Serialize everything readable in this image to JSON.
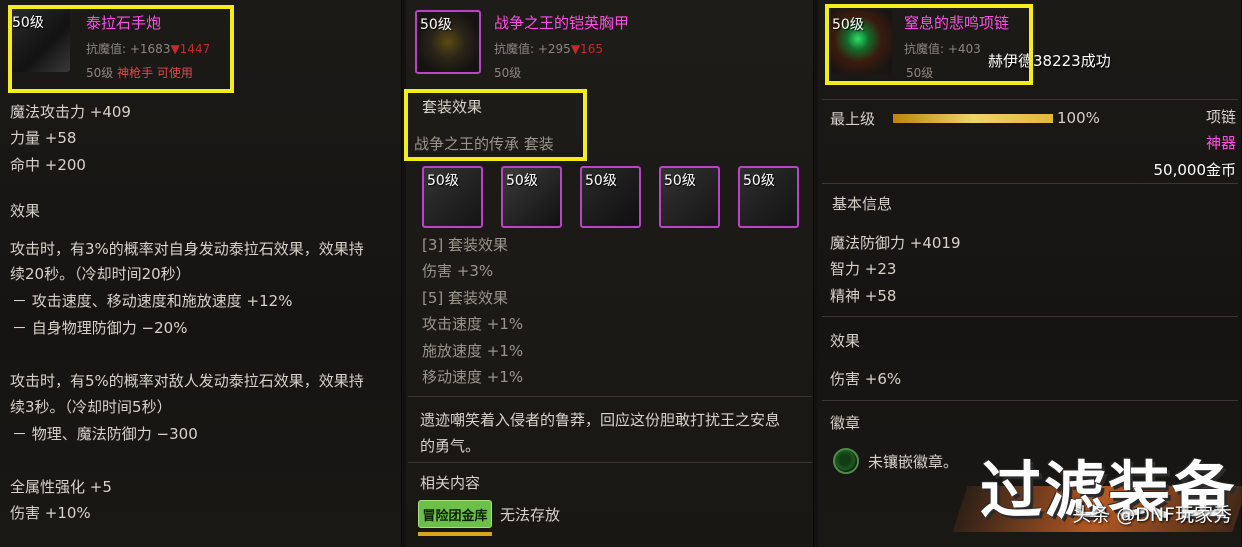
{
  "panel1": {
    "level": "50级",
    "name": "泰拉石手炮",
    "resist_label": "抗魔值: +1683",
    "resist_down": "▼1447",
    "req_level": "50级",
    "req_class": "神枪手 可使用",
    "stats": [
      "魔法攻击力 +409",
      "力量 +58",
      "命中 +200"
    ],
    "effect_header": "效果",
    "effect_lines": [
      "攻击时，有3%的概率对自身发动泰拉石效果，效果持",
      "续20秒。（冷却时间20秒）",
      "－ 攻击速度、移动速度和施放速度 +12%",
      "－ 自身物理防御力 −20%",
      "攻击时，有5%的概率对敌人发动泰拉石效果，效果持",
      "续3秒。（冷却时间5秒）",
      "－ 物理、魔法防御力 −300",
      "全属性强化 +5",
      "伤害 +10%"
    ]
  },
  "panel2": {
    "level": "50级",
    "name": "战争之王的铠英胸甲",
    "resist_label": "抗魔值: +295",
    "resist_down": "▼165",
    "req_level": "50级",
    "set_header": "套装效果",
    "set_name": "战争之王的传承  套装",
    "slots": [
      "50级",
      "50级",
      "50级",
      "50级",
      "50级"
    ],
    "set_bonus": [
      "[3] 套装效果",
      "伤害 +3%",
      "[5] 套装效果",
      "攻击速度 +1%",
      "施放速度 +1%",
      "移动速度 +1%"
    ],
    "desc": [
      "遗迹嘲笑着入侵者的鲁莽，回应这份胆敢打扰王之安息",
      "的勇气。"
    ],
    "related_header": "相关内容",
    "badge": "冒险团金库",
    "storage": "无法存放"
  },
  "panel3": {
    "level": "50级",
    "name": "窒息的悲鸣项链",
    "resist_label": "抗魔值: +403",
    "req_level": "50级",
    "notice": "赫伊德38223成功",
    "grade": "最上级",
    "grade_percent": 100,
    "grade_percent_text": "100%",
    "slot_type": "项链",
    "rarity": "神器",
    "price": "50,000金币",
    "basic_header": "基本信息",
    "stats": [
      "魔法防御力 +4019",
      "智力 +23",
      "精神 +58"
    ],
    "effect_header": "效果",
    "effect": "伤害 +6%",
    "emblem_header": "徽章",
    "emblem_text": "未镶嵌徽章。"
  },
  "watermark": {
    "big": "过滤装备",
    "small": "头条 @DNF玩家秀"
  },
  "colors": {
    "highlight": "#f5ec1c",
    "item_name": "#ff4fe6",
    "badge": "#6cc04a",
    "grade_bar": "#e4b63d"
  }
}
